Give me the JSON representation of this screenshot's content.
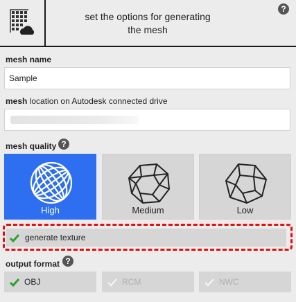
{
  "header": {
    "title": "set the options for generating\nthe mesh",
    "help_label": "?"
  },
  "mesh_name": {
    "label": "mesh name",
    "value": "Sample"
  },
  "mesh_location": {
    "label_bold": "mesh",
    "label_rest": " location on Autodesk connected drive",
    "value": ""
  },
  "mesh_quality": {
    "label": "mesh quality",
    "help_label": "?",
    "options": [
      {
        "label": "High",
        "selected": true
      },
      {
        "label": "Medium",
        "selected": false
      },
      {
        "label": "Low",
        "selected": false
      }
    ]
  },
  "texture": {
    "label": "generate texture",
    "checked": true
  },
  "output_format": {
    "label": "output format",
    "help_label": "?",
    "options": [
      {
        "label": "OBJ",
        "checked": true,
        "enabled": true
      },
      {
        "label": "RCM",
        "checked": true,
        "enabled": false
      },
      {
        "label": "NWC",
        "checked": true,
        "enabled": false
      }
    ]
  },
  "colors": {
    "selected_tile": "#2e6ef0",
    "check_green": "#2ea12e",
    "highlight_red": "#e01010"
  }
}
